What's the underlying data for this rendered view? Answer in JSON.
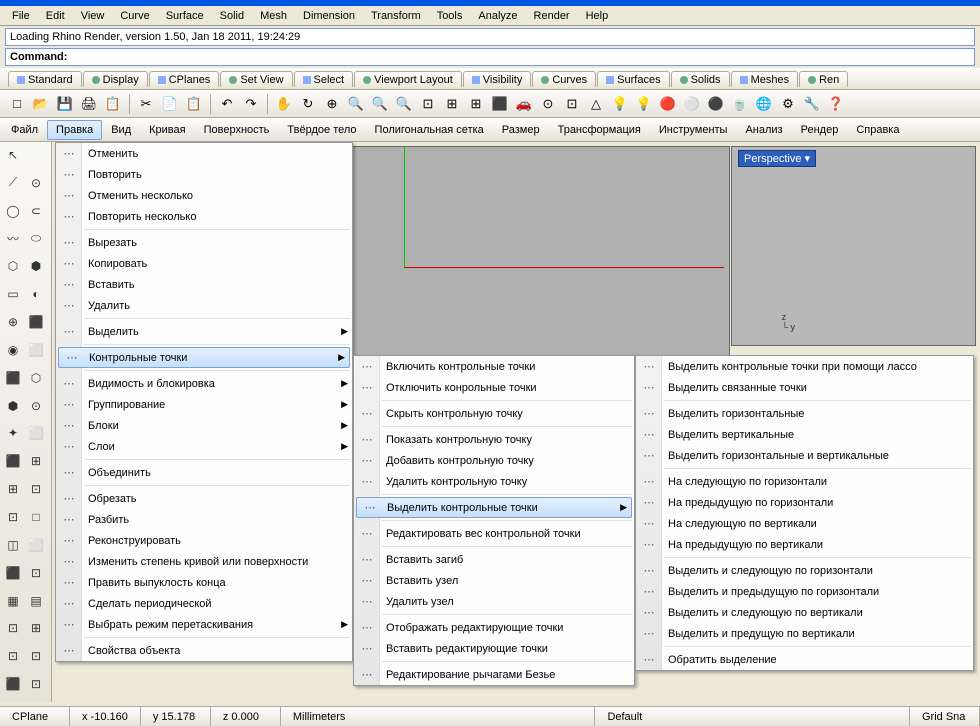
{
  "topmenu": [
    "File",
    "Edit",
    "View",
    "Curve",
    "Surface",
    "Solid",
    "Mesh",
    "Dimension",
    "Transform",
    "Tools",
    "Analyze",
    "Render",
    "Help"
  ],
  "status_line": "Loading Rhino Render, version 1.50, Jan 18 2011, 19:24:29",
  "command_label": "Command:",
  "tabs": [
    "Standard",
    "Display",
    "CPlanes",
    "Set View",
    "Select",
    "Viewport Layout",
    "Visibility",
    "Curves",
    "Surfaces",
    "Solids",
    "Meshes",
    "Ren"
  ],
  "ru_menu": [
    "Файл",
    "Правка",
    "Вид",
    "Кривая",
    "Поверхность",
    "Твёрдое тело",
    "Полигональная сетка",
    "Размер",
    "Трансформация",
    "Инструменты",
    "Анализ",
    "Рендер",
    "Справка"
  ],
  "ru_active": 1,
  "perspective_label": "Perspective",
  "editMenu": [
    {
      "t": "Отменить"
    },
    {
      "t": "Повторить"
    },
    {
      "t": "Отменить несколько"
    },
    {
      "t": "Повторить несколько"
    },
    {
      "t": "Вырезать"
    },
    {
      "t": "Копировать"
    },
    {
      "t": "Вставить"
    },
    {
      "t": "Удалить"
    },
    {
      "t": "Выделить",
      "sub": true
    },
    {
      "t": "Контрольные точки",
      "sub": true,
      "hover": true
    },
    {
      "t": "Видимость и блокировка",
      "sub": true
    },
    {
      "t": "Группирование",
      "sub": true
    },
    {
      "t": "Блоки",
      "sub": true
    },
    {
      "t": "Слои",
      "sub": true
    },
    {
      "t": "Объединить"
    },
    {
      "t": "Обрезать"
    },
    {
      "t": "Разбить"
    },
    {
      "t": "Реконструировать"
    },
    {
      "t": "Изменить степень кривой или поверхности"
    },
    {
      "t": "Править выпуклость конца"
    },
    {
      "t": "Сделать периодической"
    },
    {
      "t": "Выбрать режим перетаскивания",
      "sub": true
    },
    {
      "t": "Свойства объекта"
    }
  ],
  "cpMenu": [
    {
      "t": "Включить контрольные точки"
    },
    {
      "t": "Отключить конрольные точки"
    },
    {
      "t": "Скрыть контрольную точку"
    },
    {
      "t": "Показать контрольную точку"
    },
    {
      "t": "Добавить контрольную точку"
    },
    {
      "t": "Удалить контрольную точку"
    },
    {
      "t": "Выделить контрольные точки",
      "sub": true,
      "hover": true
    },
    {
      "t": "Редактировать вес контрольной точки"
    },
    {
      "t": "Вставить загиб"
    },
    {
      "t": "Вставить узел"
    },
    {
      "t": "Удалить узел"
    },
    {
      "t": "Отображать редактирующие точки"
    },
    {
      "t": "Вставить редактирующие точки"
    },
    {
      "t": "Редактирование рычагами Безье"
    }
  ],
  "selMenu": [
    {
      "t": "Выделить контрольные точки при помощи лассо"
    },
    {
      "t": "Выделить связанные точки"
    },
    {
      "t": "Выделить горизонтальные"
    },
    {
      "t": "Выделить вертикальные"
    },
    {
      "t": "Выделить горизонтальные и вертикальные"
    },
    {
      "t": "На следующую по горизонтали"
    },
    {
      "t": "На предыдущую по горизонтали"
    },
    {
      "t": "На следующую по вертикали"
    },
    {
      "t": "На предыдущую по вертикали"
    },
    {
      "t": "Выделить и следующую по горизонтали"
    },
    {
      "t": "Выделить и предыдущую по горизонтали"
    },
    {
      "t": "Выделить и следующую по вертикали"
    },
    {
      "t": "Выделить и предущую по вертикали"
    },
    {
      "t": "Обратить выделение"
    }
  ],
  "statusbar": {
    "cplane": "CPlane",
    "x": "x -10.160",
    "y": "y 15.178",
    "z": "z 0.000",
    "units": "Millimeters",
    "layer": "Default",
    "snap": "Grid Sna"
  },
  "toolbar_icons": [
    "□",
    "📂",
    "💾",
    "🖨",
    "📋",
    "✂",
    "📄",
    "📋",
    "↶",
    "↷",
    "✋",
    "↻",
    "⊕",
    "🔍",
    "🔍",
    "🔍",
    "⊡",
    "⊞",
    "⊞",
    "⬛",
    "🚗",
    "⊙",
    "⊡",
    "△",
    "💡",
    "💡",
    "🔴",
    "⚪",
    "⚫",
    "🍵",
    "🌐",
    "⚙",
    "🔧",
    "❓"
  ],
  "left_icons": [
    "↖",
    "",
    "⟋",
    "⊙",
    "◯",
    "⊂",
    "〰",
    "⬭",
    "⬡",
    "⬢",
    "▭",
    "◐",
    "⊕",
    "⬛",
    "◉",
    "⬜",
    "⬛",
    "⬡",
    "⬢",
    "⊙",
    "✦",
    "⬜",
    "⬛",
    "⊞",
    "⊞",
    "⊡",
    "⊡",
    "□",
    "◫",
    "⬜",
    "⬛",
    "⊡",
    "▦",
    "▤",
    "⊡",
    "⊞",
    "⊡",
    "⊡",
    "⬛",
    "⊡"
  ],
  "seps_after_edit": [
    3,
    7,
    8,
    9,
    13,
    14,
    21
  ],
  "seps_after_cp": [
    1,
    2,
    5,
    6,
    7,
    10,
    12
  ],
  "seps_after_sel": [
    1,
    4,
    8,
    12
  ]
}
